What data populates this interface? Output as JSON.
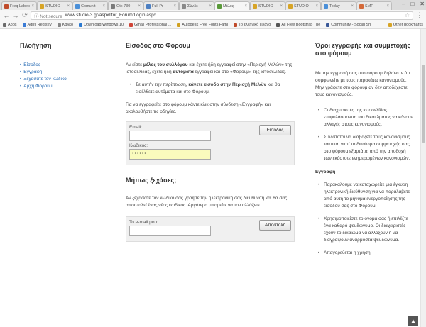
{
  "browser": {
    "tabs": [
      {
        "label": "Freq Labels",
        "color": "#c04b2b"
      },
      {
        "label": "STUDIO",
        "color": "#d7a426"
      },
      {
        "label": "Comunit",
        "color": "#4a8fd8"
      },
      {
        "label": "Gtx 730",
        "color": "#7a7a7a"
      },
      {
        "label": "Full Pr",
        "color": "#4c7fc2"
      },
      {
        "label": "Σύνδε",
        "color": "#8a8a8a"
      },
      {
        "label": "Μέλος",
        "color": "#5a9a3a",
        "active": true
      },
      {
        "label": "STUDIO",
        "color": "#d7a426"
      },
      {
        "label": "STUDIO",
        "color": "#d7a426"
      },
      {
        "label": "Today",
        "color": "#4a8fd8"
      },
      {
        "label": "SMF",
        "color": "#d46a3a"
      }
    ],
    "tab_close": "×",
    "window_controls": [
      "–",
      "□",
      "✕"
    ],
    "nav": {
      "back": "←",
      "forward": "→",
      "reload": "⟳"
    },
    "address": {
      "security": "ⓘ Not secure",
      "url": "www.studio-3.gr/aspx/lfor_Forum/Login.aspx",
      "star": "☆"
    },
    "menu": "⋮",
    "bookmarks": [
      {
        "label": "Apps",
        "color": "#6b6b6b"
      },
      {
        "label": "Agrifi Registry",
        "color": "#3a7bd5"
      },
      {
        "label": "Καλκό",
        "color": "#888"
      },
      {
        "label": "Download Windows 10",
        "color": "#2b79d0"
      },
      {
        "label": "Gmail Professional ...",
        "color": "#d04437"
      },
      {
        "label": "Autodesk Free Fonts Fami",
        "color": "#d0a020"
      },
      {
        "label": "Το ελληνικό Πλάνο",
        "color": "#c04b2b"
      },
      {
        "label": "All Free Bootstrap The",
        "color": "#555"
      },
      {
        "label": "Community - Social Sh",
        "color": "#3b5998"
      },
      {
        "label": "Other bookmarks",
        "color": "#d7a426"
      }
    ]
  },
  "sidebar": {
    "title": "Πλοήγηση",
    "items": [
      "Είσοδος",
      "Εγγραφή",
      "Ξεχάσατε τον κωδικό;",
      "Αρχή Φόρουμ"
    ]
  },
  "main": {
    "login_title": "Είσοδος στο Φόρουμ",
    "intro_1": "Αν είστε ",
    "intro_bold_1": "μέλος του συλλόγου",
    "intro_2": " και έχετε ήδη εγγραφεί στην «Περιοχή Μελών» της ιστοσελίδας, έχετε ήδη ",
    "intro_bold_2": "αυτόματα",
    "intro_3": " εγγραφεί και στο «Φόρουμ» της ιστοσελίδας.",
    "bullet_1": "Σε αυτήν την περίπτωση, ",
    "bullet_1_bold": "κάνετε είσοδο στην Περιοχή Μελών",
    "bullet_1_end": " και θα εισέλθετε αυτόματα και στο Φόρουμ.",
    "register_para": "Για να εγγραφείτε στο φόρουμ κάντε κλικ στην σύνδεση «Εγγραφή» και ακολουθήστε τις οδηγίες.",
    "email_label": "Email:",
    "email_value": "",
    "password_label": "Κωδικός:",
    "password_value": "••••••",
    "login_button": "Είσοδος",
    "forgot_title": "Μήπως ξεχάσες;",
    "forgot_para": "Αν ξεχάσατε τον κωδικό σας γράψτε την ηλεκτρονική σας διεύθυνση και θα σας αποσταλεί ένας νέος κωδικός. Αργότερα μπορείτε να τον αλλάξετε.",
    "your_email_label": "Το e-mail μου:",
    "your_email_value": "",
    "send_button": "Αποστολή"
  },
  "rightcol": {
    "title": "Όροι εγγραφής και συμμετοχής στο φόρουμ",
    "intro": "Με την εγγραφή σας στο φόρουμ δηλώνετε ότι συμφωνείτε με τους παρακάτω κανονισμούς. Μην γράφετε στο φόρουμ αν δεν αποδέχεστε τους κανονισμούς.",
    "rules": [
      "Οι διαχειριστές της ιστοσελίδας επιφυλάσσονται του δικαιώματος να κάνουν αλλαγές στους κανονισμούς.",
      "Συνιστάται να διαβάζετε τους κανονισμούς τακτικά, γιατί το δικαίωμα συμμετοχής σας στο φόρουμ εξαρτάται από την αποδοχή των εκάστοτε ενημερωμένων κανονισμών."
    ],
    "section_title": "Εγγραφή",
    "register_rules": [
      "Παρακαλούμε να καταχωρείτε μια έγκυρη ηλεκτρονική διεύθυνση για να παραλάβετε από αυτή το μήνυμα ενεργοποίησης της εισόδου σας στο Φόρουμ.",
      "Χρησιμοποιείστε το όνομά σας ή επιλέξτε ένα καθαρό ψευδώνυμο. Οι διαχειριστές έχουν το δικαίωμα να αλλάξουν ή να διαγράψουν ανάρμοστα ψευδώνυμα.",
      "Απαγορεύεται η χρήση"
    ]
  },
  "scroll_top": "▲"
}
